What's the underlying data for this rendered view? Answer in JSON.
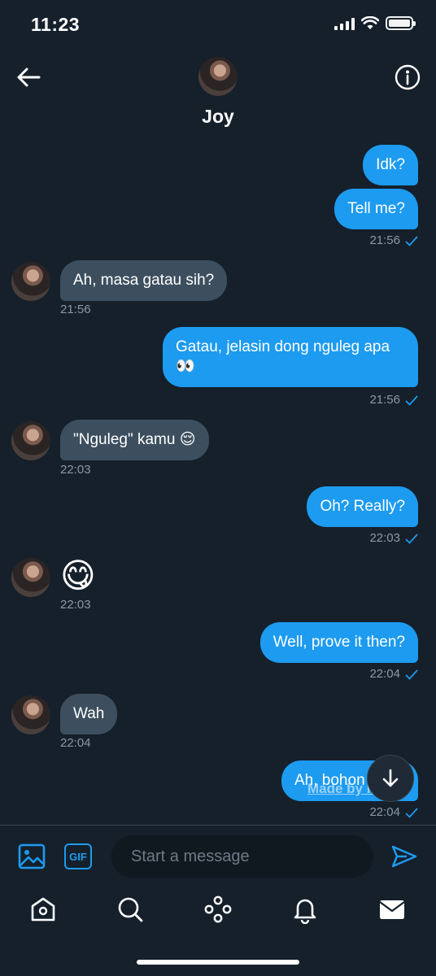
{
  "status_bar": {
    "time": "11:23"
  },
  "header": {
    "name": "Joy"
  },
  "messages": [
    {
      "dir": "out",
      "text": "Idk?"
    },
    {
      "dir": "out",
      "text": "Tell me?",
      "time": "21:56"
    },
    {
      "dir": "in",
      "text": "Ah, masa gatau sih?",
      "time": "21:56"
    },
    {
      "dir": "out",
      "text": "Gatau, jelasin dong nguleg apa",
      "text2": "👀",
      "time": "21:56"
    },
    {
      "dir": "in",
      "text": "\"Nguleg\" kamu 😌",
      "time": "22:03"
    },
    {
      "dir": "out",
      "text": "Oh? Really?",
      "time": "22:03"
    },
    {
      "dir": "in",
      "text": "😋",
      "time": "22:03"
    },
    {
      "dir": "out",
      "text": "Well, prove it then?",
      "time": "22:04"
    },
    {
      "dir": "in",
      "text": "Wah",
      "time": "22:04"
    },
    {
      "dir": "out",
      "text": "Ah, bohon",
      "time": "22:04"
    }
  ],
  "watermark": "Made by iFake",
  "composer": {
    "placeholder": "Start a message",
    "gif_label": "GIF"
  },
  "colors": {
    "accent": "#1d9bf0",
    "background": "#15202b",
    "incoming": "#3d4f5f"
  },
  "icons": [
    "back-arrow-icon",
    "info-icon",
    "image-icon",
    "gif-icon",
    "send-icon",
    "home-icon",
    "search-icon",
    "spaces-icon",
    "bell-icon",
    "mail-icon",
    "arrow-down-icon",
    "check-icon"
  ]
}
